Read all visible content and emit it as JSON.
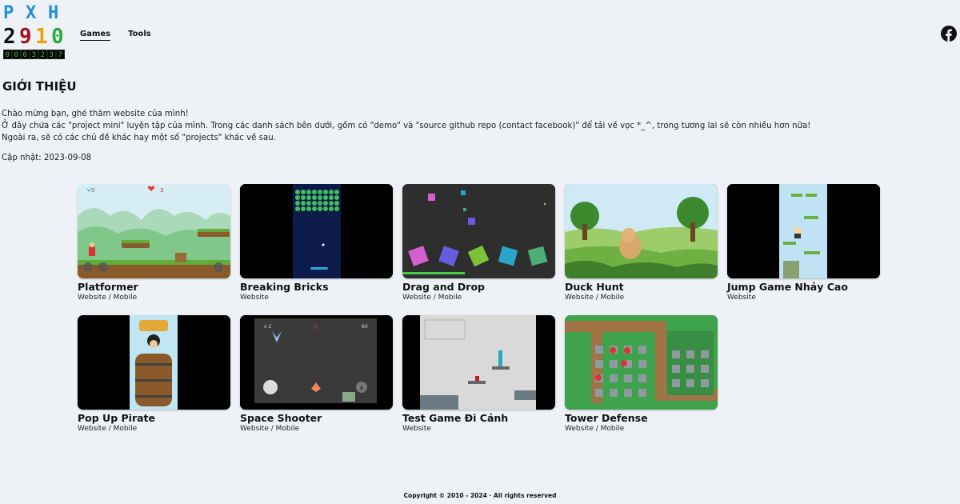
{
  "logo": {
    "letters": [
      "P",
      "X",
      "H"
    ],
    "digits": [
      {
        "d": "2",
        "color": "#111111"
      },
      {
        "d": "9",
        "color": "#a8101e"
      },
      {
        "d": "1",
        "color": "#f0a000"
      },
      {
        "d": "0",
        "color": "#2eaa3a"
      }
    ],
    "counter": [
      "0",
      "0",
      "0",
      "3",
      "2",
      "3",
      "7"
    ]
  },
  "nav": {
    "games": "Games",
    "tools": "Tools"
  },
  "intro": {
    "title": "GIỚI THIỆU",
    "line1": "Chào mừng bạn, ghé thăm website của mình!",
    "line2": "Ở đây chứa các \"project mini\" luyện tập của mình. Trong các danh sách bên dưới, gồm có \"demo\" và \"source github repo (contact facebook)\" để tải về vọc *_^, trong tương lai sẽ còn nhiều hơn nữa!",
    "line3": "Ngoài ra, sẽ có các chủ đề khác hay một số \"projects\" khác về sau.",
    "updated": "Cập nhật: 2023-09-08"
  },
  "games": [
    {
      "title": "Platformer",
      "platform": "Website / Mobile",
      "hud": [
        "0",
        "3"
      ]
    },
    {
      "title": "Breaking Bricks",
      "platform": "Website"
    },
    {
      "title": "Drag and Drop",
      "platform": "Website / Mobile"
    },
    {
      "title": "Duck Hunt",
      "platform": "Website / Mobile"
    },
    {
      "title": "Jump Game Nhảy Cao",
      "platform": "Website"
    },
    {
      "title": "Pop Up Pirate",
      "platform": "Website / Mobile"
    },
    {
      "title": "Space Shooter",
      "platform": "Website / Mobile",
      "hud": [
        "x 2",
        "II",
        "60",
        "A"
      ]
    },
    {
      "title": "Test Game Đi Cảnh",
      "platform": "Website"
    },
    {
      "title": "Tower Defense",
      "platform": "Website / Mobile"
    }
  ],
  "footer": "Copyright © 2010 - 2024 · All rights reserved"
}
